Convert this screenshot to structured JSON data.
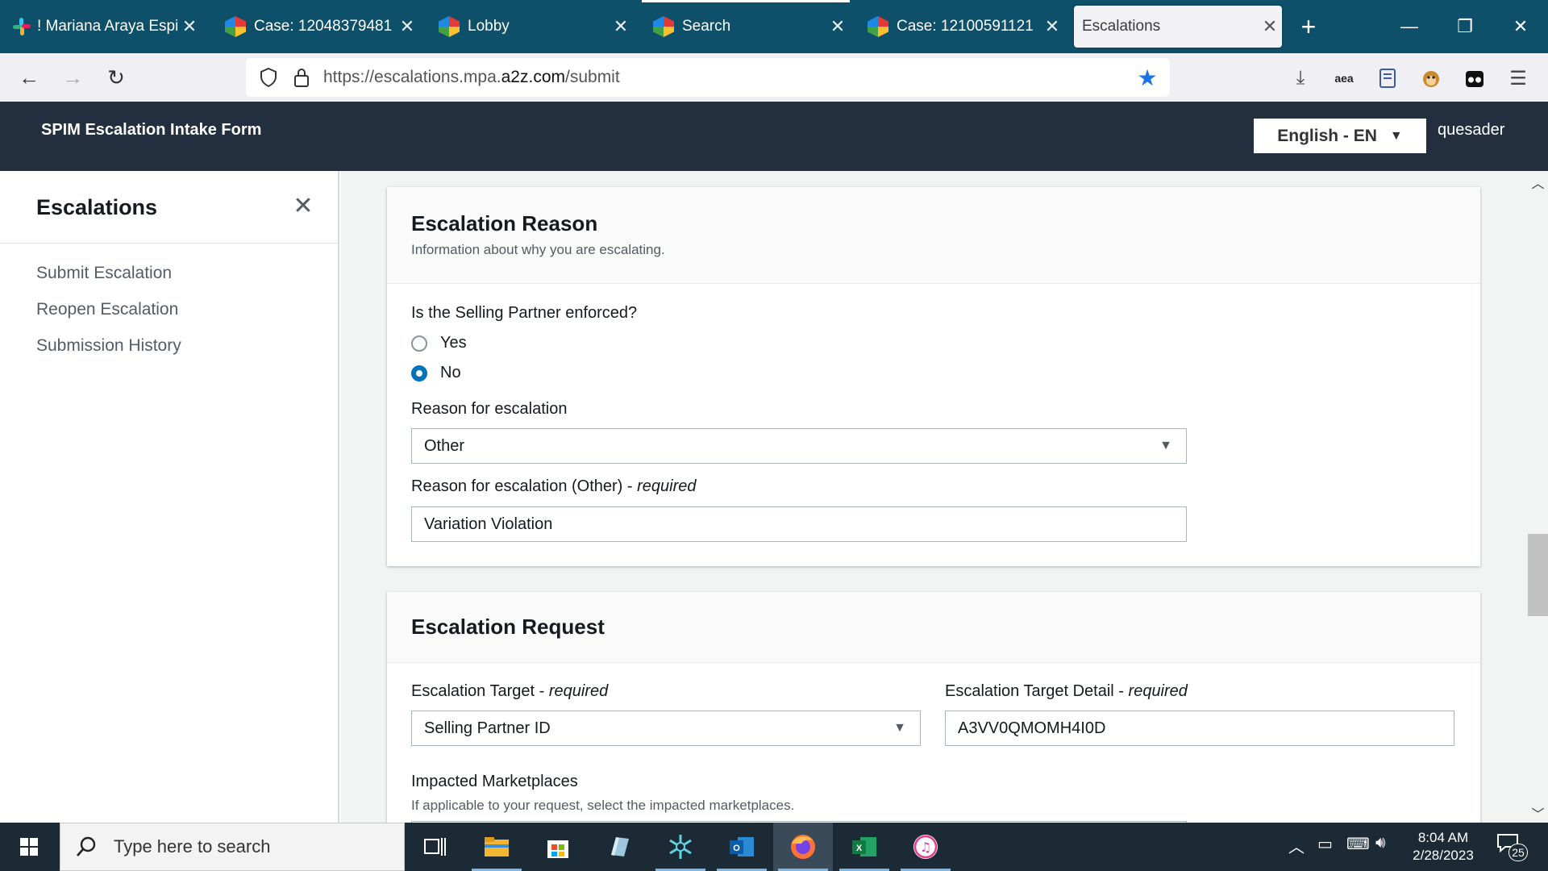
{
  "browser": {
    "tabs": [
      {
        "title": "! Mariana Araya Espinoza",
        "icon": "slack-icon"
      },
      {
        "title": "Case: 12048379481",
        "icon": "paragon-icon"
      },
      {
        "title": "Lobby",
        "icon": "paragon-icon"
      },
      {
        "title": "Search",
        "icon": "paragon-icon"
      },
      {
        "title": "Case: 12100591121",
        "icon": "paragon-icon"
      },
      {
        "title": "Escalations",
        "icon": "none",
        "active": true
      }
    ],
    "new_tab": "+",
    "url": {
      "prefix": "https://escalations.mpa.",
      "domain": "a2z.com",
      "suffix": "/submit"
    },
    "toolbar_icons": [
      "download-icon",
      "amazon-extension-icon",
      "reader-icon",
      "monkey-extension-icon",
      "incognito-extension-icon",
      "menu-icon"
    ],
    "aea_label": "aea"
  },
  "app": {
    "title": "SPIM Escalation Intake Form",
    "language": "English - EN",
    "user": "quesader"
  },
  "sidebar": {
    "title": "Escalations",
    "items": [
      {
        "label": "Submit Escalation"
      },
      {
        "label": "Reopen Escalation"
      },
      {
        "label": "Submission History"
      }
    ]
  },
  "reason_panel": {
    "title": "Escalation Reason",
    "description": "Information about why you are escalating.",
    "enforced_question": "Is the Selling Partner enforced?",
    "options": [
      {
        "label": "Yes",
        "checked": false
      },
      {
        "label": "No",
        "checked": true
      }
    ],
    "reason_label": "Reason for escalation",
    "reason_value": "Other",
    "other_label": "Reason for escalation (Other)",
    "required_suffix": "required",
    "separator": " - ",
    "other_value": "Variation Violation"
  },
  "request_panel": {
    "title": "Escalation Request",
    "target_label": "Escalation Target",
    "target_value": "Selling Partner ID",
    "target_detail_label": "Escalation Target Detail",
    "target_detail_value": "A3VV0QMOMH4I0D",
    "marketplaces_label": "Impacted Marketplaces",
    "marketplaces_desc": "If applicable to your request, select the impacted marketplaces."
  },
  "taskbar": {
    "search_placeholder": "Type here to search",
    "apps": [
      "task-view-icon",
      "file-explorer-icon",
      "store-icon",
      "notes-app-icon",
      "network-app-icon",
      "outlook-icon",
      "firefox-icon",
      "excel-icon",
      "itunes-icon"
    ],
    "time": "8:04 AM",
    "date": "2/28/2023",
    "notification_count": "25"
  },
  "colors": {
    "tab_strip": "#0e4f6a",
    "app_header": "#232f3e",
    "radio_accent": "#0073bb",
    "taskbar": "#1c2a36"
  }
}
